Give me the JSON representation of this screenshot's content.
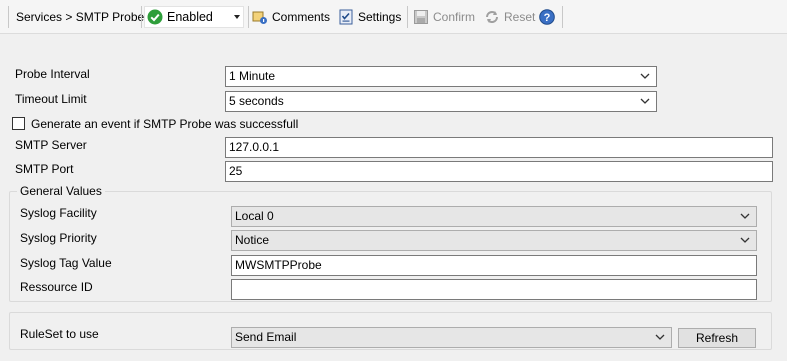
{
  "toolbar": {
    "breadcrumb": "Services > SMTP Probe",
    "status": "Enabled",
    "comments": "Comments",
    "settings": "Settings",
    "confirm": "Confirm",
    "reset": "Reset"
  },
  "form": {
    "probe_interval_label": "Probe Interval",
    "probe_interval_value": "1 Minute",
    "timeout_label": "Timeout Limit",
    "timeout_value": "5 seconds",
    "event_checkbox_label": "Generate an event if SMTP Probe was successfull",
    "smtp_server_label": "SMTP Server",
    "smtp_server_value": "127.0.0.1",
    "smtp_port_label": "SMTP Port",
    "smtp_port_value": "25"
  },
  "general": {
    "title": "General Values",
    "facility_label": "Syslog Facility",
    "facility_value": "Local 0",
    "priority_label": "Syslog Priority",
    "priority_value": "Notice",
    "tag_label": "Syslog Tag Value",
    "tag_value": "MWSMTPProbe",
    "resource_label": "Ressource ID",
    "resource_value": ""
  },
  "ruleset": {
    "label": "RuleSet to use",
    "value": "Send Email",
    "refresh": "Refresh"
  },
  "colors": {
    "enabled_green": "#2e9e3a",
    "help_blue": "#3a6fc4"
  }
}
